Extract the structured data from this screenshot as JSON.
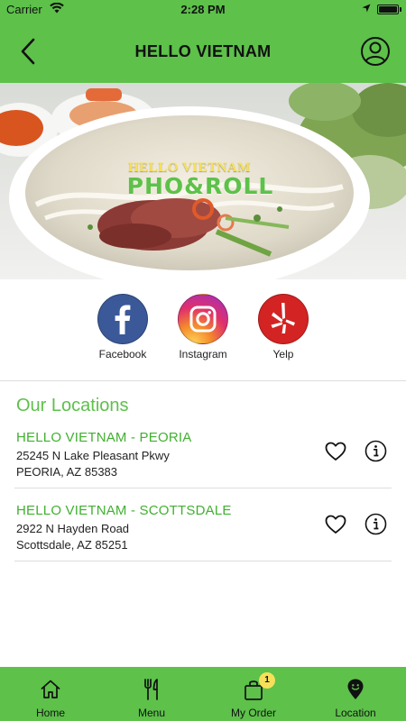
{
  "status_bar": {
    "carrier": "Carrier",
    "time": "2:28 PM"
  },
  "header": {
    "title": "HELLO VIETNAM",
    "back_icon": "chevron-left-icon",
    "profile_icon": "user-circle-icon"
  },
  "hero": {
    "logo_line1": "HELLO VIETNAM",
    "logo_line2": "PHO&ROLL"
  },
  "social": [
    {
      "label": "Facebook",
      "icon": "facebook-icon",
      "color": "#3b5998"
    },
    {
      "label": "Instagram",
      "icon": "instagram-icon",
      "color": "#e0306b"
    },
    {
      "label": "Yelp",
      "icon": "yelp-icon",
      "color": "#d32323"
    }
  ],
  "locations": {
    "title": "Our Locations",
    "items": [
      {
        "name": "HELLO VIETNAM - PEORIA",
        "address1": "25245 N Lake Pleasant Pkwy",
        "address2": "PEORIA, AZ 85383"
      },
      {
        "name": "HELLO VIETNAM - SCOTTSDALE",
        "address1": "2922 N Hayden Road",
        "address2": "Scottsdale, AZ 85251"
      }
    ]
  },
  "tabbar": {
    "items": [
      {
        "label": "Home",
        "icon": "home-icon"
      },
      {
        "label": "Menu",
        "icon": "fork-knife-icon"
      },
      {
        "label": "My Order",
        "icon": "shopping-bag-icon",
        "badge": "1"
      },
      {
        "label": "Location",
        "icon": "location-pin-icon"
      }
    ]
  },
  "colors": {
    "brand_green": "#5dc14a",
    "location_name_green": "#41b030",
    "badge_yellow": "#f6e05a"
  }
}
